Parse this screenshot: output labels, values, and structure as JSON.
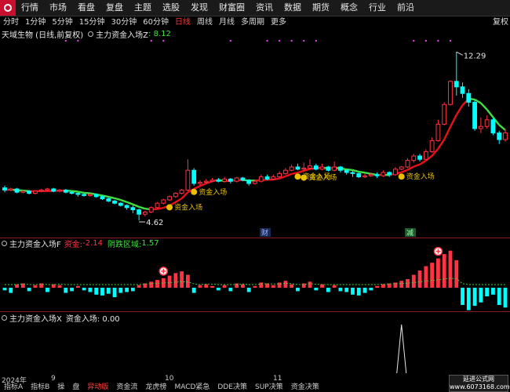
{
  "menubar": {
    "items": [
      "行情",
      "市场",
      "看盘",
      "复盘",
      "主题",
      "选股",
      "发现",
      "财富圈",
      "资讯",
      "数据",
      "期货",
      "概念",
      "行业",
      "前沿"
    ]
  },
  "toolbar": {
    "periods": [
      "分时",
      "1分钟",
      "5分钟",
      "15分钟",
      "30分钟",
      "60分钟",
      "日线",
      "周线",
      "月线",
      "多周期",
      "更多"
    ],
    "active": "日线",
    "right": "复权"
  },
  "main_panel": {
    "stock_title": "天域生物 (日线,前复权)",
    "indicator_name": "主力资金入场Z",
    "indicator_value": ": 8.12",
    "max_label": "12.29",
    "min_label": "4.62",
    "signal_label": "资金入场",
    "event_cai": "财",
    "event_jian": "减"
  },
  "mid_panel": {
    "name": "主力资金入场F",
    "k1": "资金: ",
    "v1": "-2.14",
    "k2": "阴跌区域: ",
    "v2": "1.57"
  },
  "low_panel": {
    "name": "主力资金入场X",
    "label": "资金入场: 0.00"
  },
  "date_axis": [
    "2024年",
    "9",
    "10",
    "11"
  ],
  "bottom_tabs": [
    "指标A",
    "指标B",
    "操",
    "盘",
    "异动版",
    "资金流",
    "龙虎榜",
    "MACD紧急",
    "DDE决策",
    "SUP决策",
    "资金决策"
  ],
  "bottom_tabs_selected": "异动版",
  "watermark": [
    "延进公式网",
    "www.6073168.com"
  ],
  "colors": {
    "up": "#ff3344",
    "down": "#00ffff",
    "ma_red": "#e8101a",
    "ma_green": "#40e040",
    "label": "#e8c000"
  },
  "chart_data": {
    "type": "candlestick",
    "price_range": [
      4.3,
      12.8
    ],
    "high": 12.29,
    "low": 4.62,
    "candles": [
      [
        6.1,
        6.0,
        6.2,
        5.9
      ],
      [
        6.0,
        6.05,
        6.1,
        5.95
      ],
      [
        6.05,
        5.9,
        6.1,
        5.85
      ],
      [
        5.9,
        5.95,
        6.0,
        5.85
      ],
      [
        5.95,
        5.85,
        6.0,
        5.8
      ],
      [
        5.85,
        5.95,
        6.0,
        5.8
      ],
      [
        5.95,
        6.0,
        6.05,
        5.9
      ],
      [
        6.0,
        6.05,
        6.1,
        5.95
      ],
      [
        6.05,
        5.95,
        6.1,
        5.9
      ],
      [
        5.95,
        6.0,
        6.05,
        5.9
      ],
      [
        6.0,
        5.9,
        6.05,
        5.85
      ],
      [
        5.9,
        5.85,
        5.95,
        5.8
      ],
      [
        5.85,
        5.8,
        5.9,
        5.7
      ],
      [
        5.8,
        5.75,
        5.85,
        5.7
      ],
      [
        5.75,
        5.8,
        5.85,
        5.7
      ],
      [
        5.8,
        5.7,
        5.85,
        5.65
      ],
      [
        5.7,
        5.6,
        5.75,
        5.55
      ],
      [
        5.6,
        5.5,
        5.65,
        5.45
      ],
      [
        5.5,
        5.4,
        5.55,
        5.35
      ],
      [
        5.4,
        5.3,
        5.45,
        5.25
      ],
      [
        5.3,
        5.2,
        5.35,
        5.1
      ],
      [
        5.2,
        5.1,
        5.3,
        4.95
      ],
      [
        5.1,
        4.9,
        5.15,
        4.62
      ],
      [
        4.9,
        5.0,
        5.05,
        4.8
      ],
      [
        5.0,
        5.2,
        5.25,
        4.95
      ],
      [
        5.2,
        5.4,
        5.45,
        5.15
      ],
      [
        5.4,
        5.55,
        5.6,
        5.35
      ],
      [
        5.55,
        5.7,
        5.75,
        5.5
      ],
      [
        5.7,
        5.85,
        5.9,
        5.65
      ],
      [
        5.85,
        6.0,
        6.05,
        5.8
      ],
      [
        6.0,
        6.9,
        7.4,
        5.95
      ],
      [
        6.9,
        6.3,
        7.0,
        6.2
      ],
      [
        6.3,
        6.35,
        6.45,
        6.2
      ],
      [
        6.35,
        6.4,
        6.5,
        6.3
      ],
      [
        6.4,
        6.45,
        6.55,
        6.35
      ],
      [
        6.45,
        6.4,
        6.55,
        6.35
      ],
      [
        6.4,
        6.5,
        6.6,
        6.35
      ],
      [
        6.5,
        6.4,
        6.55,
        6.3
      ],
      [
        6.4,
        6.55,
        6.6,
        6.35
      ],
      [
        6.55,
        6.45,
        6.6,
        6.4
      ],
      [
        6.45,
        6.3,
        6.5,
        6.2
      ],
      [
        6.3,
        6.4,
        6.45,
        6.25
      ],
      [
        6.4,
        6.6,
        6.7,
        6.35
      ],
      [
        6.6,
        6.5,
        6.7,
        6.45
      ],
      [
        6.5,
        6.6,
        6.7,
        6.45
      ],
      [
        6.6,
        6.75,
        6.85,
        6.55
      ],
      [
        6.75,
        6.9,
        7.0,
        6.7
      ],
      [
        6.9,
        7.05,
        7.15,
        6.85
      ],
      [
        7.05,
        6.95,
        7.2,
        6.9
      ],
      [
        6.95,
        7.0,
        7.25,
        6.85
      ],
      [
        7.0,
        7.1,
        7.4,
        6.95
      ],
      [
        7.1,
        6.95,
        7.2,
        6.9
      ],
      [
        6.95,
        7.05,
        7.2,
        6.9
      ],
      [
        7.05,
        6.9,
        7.1,
        6.85
      ],
      [
        6.9,
        7.05,
        7.3,
        6.85
      ],
      [
        7.05,
        6.9,
        7.1,
        6.8
      ],
      [
        6.9,
        6.8,
        6.95,
        6.7
      ],
      [
        6.8,
        6.75,
        6.9,
        6.6
      ],
      [
        6.75,
        6.6,
        6.8,
        6.55
      ],
      [
        6.6,
        6.65,
        6.75,
        6.55
      ],
      [
        6.65,
        6.7,
        6.8,
        6.6
      ],
      [
        6.7,
        6.65,
        6.8,
        6.55
      ],
      [
        6.65,
        6.8,
        6.9,
        6.6
      ],
      [
        6.8,
        6.7,
        6.85,
        6.6
      ],
      [
        6.7,
        6.95,
        7.05,
        6.65
      ],
      [
        6.95,
        7.05,
        7.1,
        6.9
      ],
      [
        7.05,
        7.35,
        7.45,
        7.0
      ],
      [
        7.35,
        7.55,
        7.65,
        7.25
      ],
      [
        7.55,
        7.4,
        7.65,
        7.3
      ],
      [
        7.4,
        7.75,
        7.85,
        7.35
      ],
      [
        7.75,
        8.25,
        8.4,
        7.7
      ],
      [
        8.25,
        9.0,
        9.2,
        8.2
      ],
      [
        9.0,
        9.9,
        10.0,
        8.95
      ],
      [
        9.9,
        10.95,
        11.0,
        9.85
      ],
      [
        10.95,
        10.7,
        12.29,
        10.3
      ],
      [
        10.7,
        10.4,
        10.9,
        10.2
      ],
      [
        10.4,
        10.0,
        10.6,
        9.8
      ],
      [
        10.0,
        8.8,
        10.1,
        8.7
      ],
      [
        8.8,
        8.9,
        9.3,
        8.6
      ],
      [
        8.9,
        9.2,
        9.4,
        8.8
      ],
      [
        9.2,
        8.6,
        9.3,
        8.5
      ],
      [
        8.6,
        8.3,
        8.7,
        8.1
      ],
      [
        8.3,
        8.6,
        8.8,
        8.2
      ]
    ],
    "signals_at": [
      27,
      31,
      48,
      49,
      65
    ],
    "osc": [
      -0.3,
      -0.6,
      0.4,
      0.5,
      -0.4,
      0.3,
      0.5,
      -0.5,
      0.4,
      0.3,
      -0.6,
      -0.4,
      0.2,
      -0.3,
      -0.5,
      -0.8,
      -0.9,
      -0.7,
      -1.1,
      -0.6,
      -0.5,
      -0.4,
      0.3,
      0.5,
      0.7,
      0.9,
      1.1,
      1.4,
      1.7,
      1.9,
      1.5,
      -0.6,
      0.3,
      0.4,
      0.2,
      -0.3,
      0.3,
      -0.4,
      0.5,
      0.4,
      -0.5,
      0.2,
      0.6,
      0.5,
      0.3,
      0.6,
      0.8,
      0.4,
      -0.4,
      0.5,
      0.7,
      -0.3,
      0.4,
      -0.5,
      0.3,
      -0.4,
      -0.5,
      -0.8,
      -0.9,
      -0.6,
      -0.3,
      0.2,
      0.4,
      0.5,
      0.6,
      0.8,
      1.0,
      1.5,
      2.0,
      2.5,
      2.9,
      3.4,
      3.9,
      4.3,
      3.2,
      -2.0,
      -2.6,
      -2.1,
      -1.7,
      -1.0,
      -0.8,
      -2.0,
      -2.3
    ],
    "spike_at": 65,
    "spike_value": 1.0
  }
}
